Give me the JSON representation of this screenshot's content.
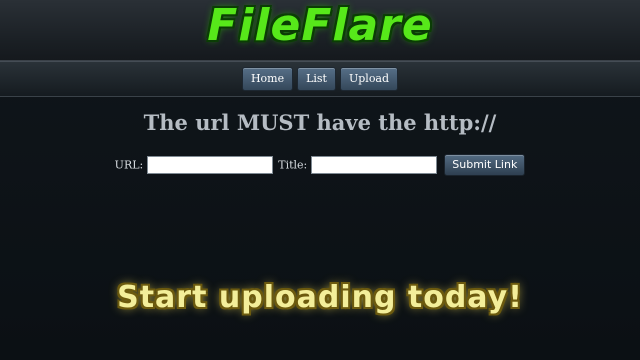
{
  "header": {
    "logo_text": "FileFlare"
  },
  "nav": {
    "items": [
      {
        "label": "Home"
      },
      {
        "label": "List"
      },
      {
        "label": "Upload"
      }
    ]
  },
  "main": {
    "headline": "The url MUST have the http://",
    "form": {
      "url_label": "URL:",
      "url_value": "",
      "title_label": "Title:",
      "title_value": "",
      "submit_label": "Submit Link"
    },
    "promo": "Start uploading today!"
  },
  "colors": {
    "logo": "#57e81a",
    "promo": "#f3ee9a",
    "button": "#4a6076",
    "background": "#0f1418"
  }
}
